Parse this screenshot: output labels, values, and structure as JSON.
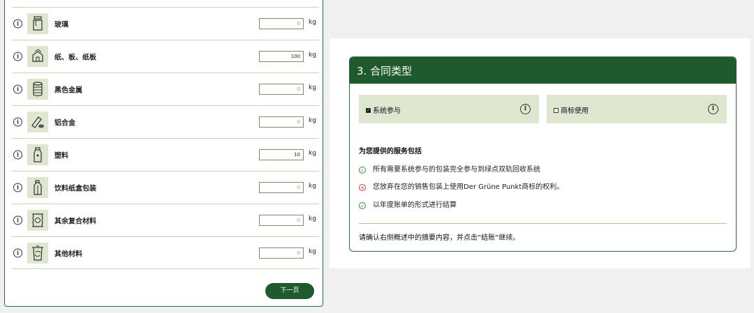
{
  "materials": [
    {
      "label": "玻璃",
      "value": "0",
      "unit": "kg",
      "icon": "glass-jar-icon",
      "filled": false
    },
    {
      "label": "纸、板、纸板",
      "value": "100",
      "unit": "kg",
      "icon": "paper-cardboard-icon",
      "filled": true
    },
    {
      "label": "黑色金属",
      "value": "0",
      "unit": "kg",
      "icon": "tin-can-icon",
      "filled": false
    },
    {
      "label": "铝合金",
      "value": "0",
      "unit": "kg",
      "icon": "aluminium-icon",
      "filled": false
    },
    {
      "label": "塑料",
      "value": "10",
      "unit": "kg",
      "icon": "plastic-bottle-icon",
      "filled": true
    },
    {
      "label": "饮料纸盒包装",
      "value": "0",
      "unit": "kg",
      "icon": "beverage-carton-icon",
      "filled": false
    },
    {
      "label": "其余复合材料",
      "value": "0",
      "unit": "kg",
      "icon": "composite-pouch-icon",
      "filled": false
    },
    {
      "label": "其他材料",
      "value": "0",
      "unit": "kg",
      "icon": "recycle-bin-icon",
      "filled": false
    }
  ],
  "info_glyph": "i",
  "next_button": "下一页",
  "contract": {
    "title": "3. 合同类型",
    "options": [
      {
        "label": "系统参与",
        "checked": true
      },
      {
        "label": "商标使用",
        "checked": false
      }
    ],
    "services_title": "为您提供的服务包括",
    "services": [
      {
        "text": "所有需要系统参与的包装完全参与到绿点双轨回收系统",
        "status": "included"
      },
      {
        "text": "您放弃在您的销售包装上使用Der Grüne Punkt商标的权利。",
        "status": "excluded"
      },
      {
        "text": "以年度账单的形式进行结算",
        "status": "included"
      }
    ],
    "note": "请确认右侧概述中的摘要内容，并点击”结账”继续。"
  },
  "colors": {
    "brand_green": "#1f5a2c",
    "icon_bg": "#dde6cf",
    "ok": "#3a8a3a",
    "error": "#d23a3a"
  }
}
